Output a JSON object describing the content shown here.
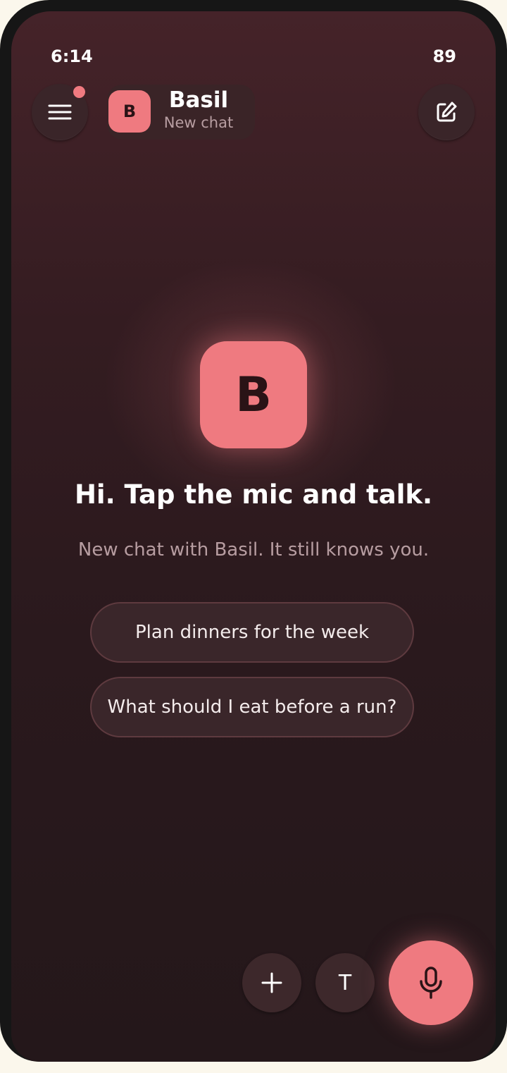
{
  "status_bar": {
    "time": "6:14",
    "battery": "89"
  },
  "header": {
    "avatar_letter": "B",
    "name": "Basil",
    "subtitle": "New chat",
    "has_notification": true
  },
  "hero": {
    "avatar_letter": "B",
    "greeting": "Hi. Tap the mic and talk.",
    "subtitle": "New chat with Basil. It still knows you."
  },
  "suggestions": [
    "Plan dinners for the week",
    "What should I eat before a run?"
  ],
  "controls": {
    "text_button_label": "T",
    "icons": [
      "menu-icon",
      "edit-icon",
      "plus-icon",
      "mic-icon"
    ]
  },
  "colors": {
    "accent": "#ef7a80",
    "background_top": "#452329",
    "background_bottom": "#24171a"
  }
}
